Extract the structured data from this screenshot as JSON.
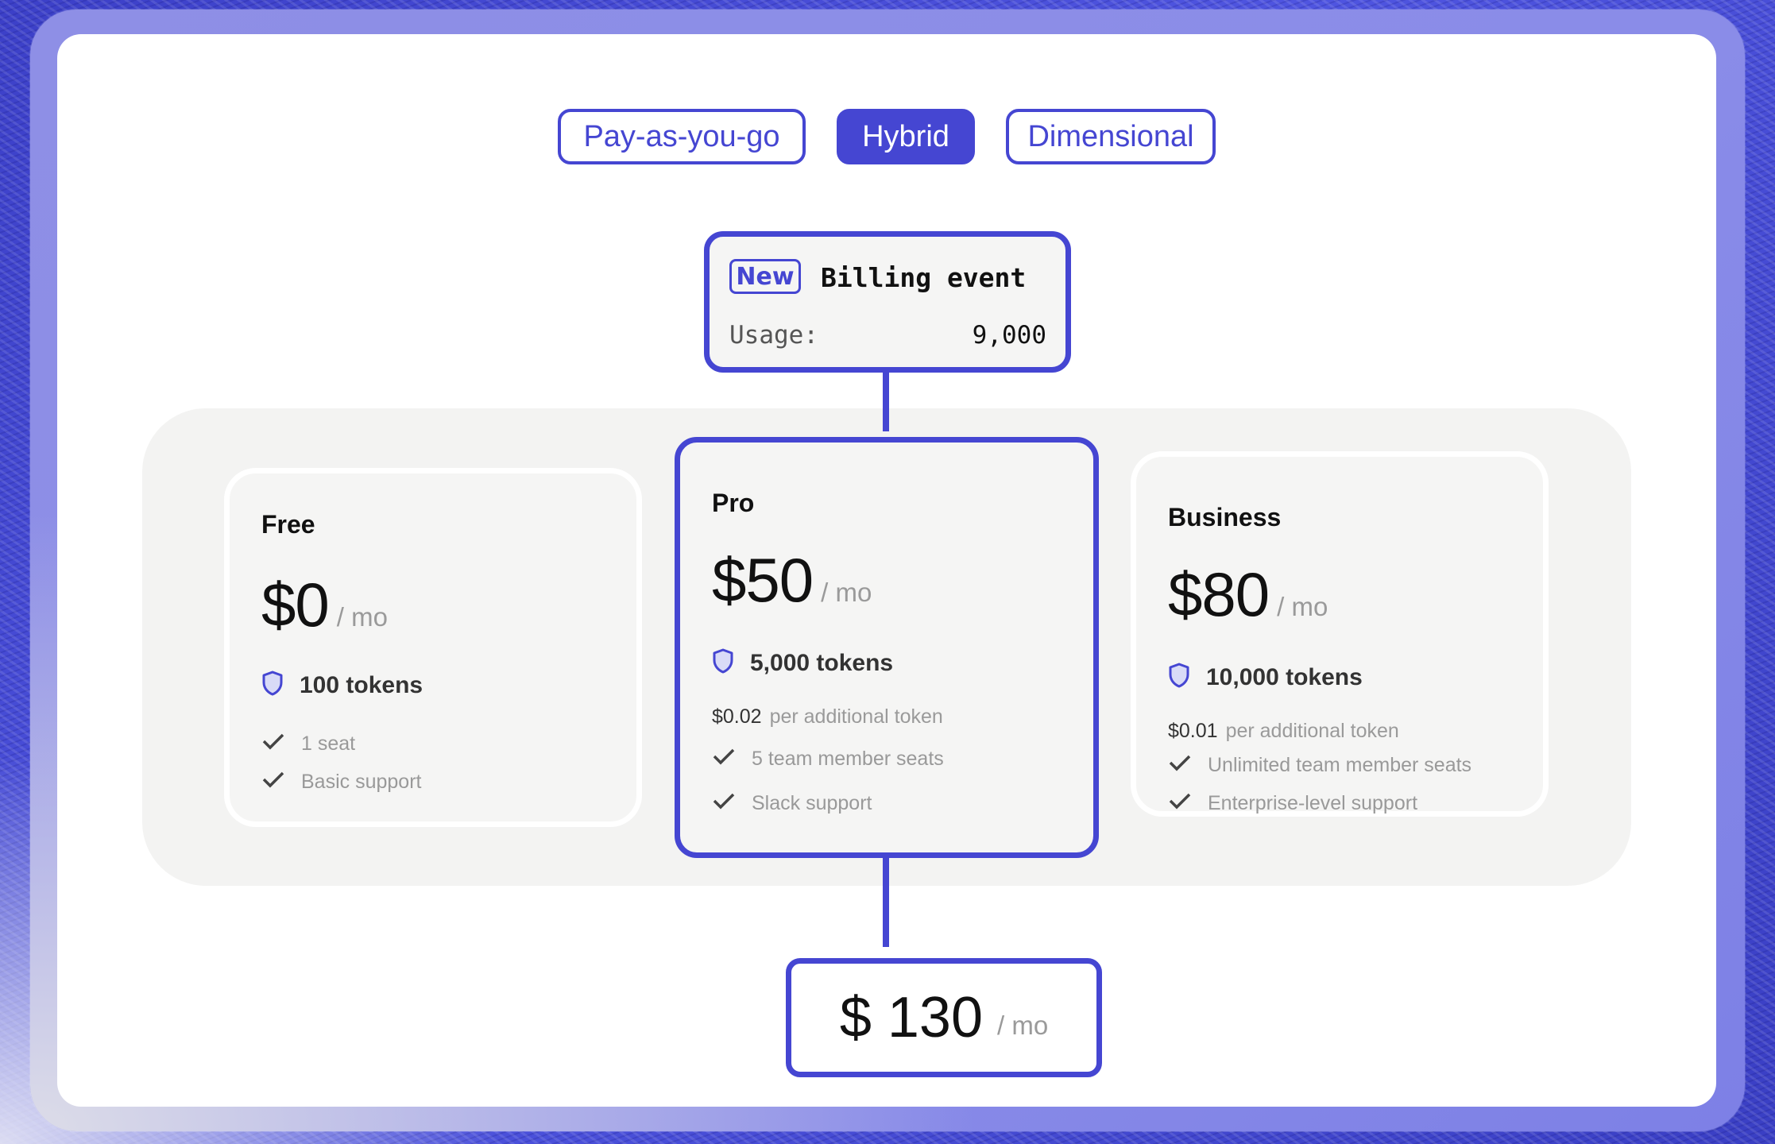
{
  "tabs": [
    {
      "label": "Pay-as-you-go",
      "active": false
    },
    {
      "label": "Hybrid",
      "active": true
    },
    {
      "label": "Dimensional",
      "active": false
    }
  ],
  "billing_event": {
    "badge": "New",
    "title": "Billing event",
    "usage_label": "Usage:",
    "usage_value": "9,000"
  },
  "plans": [
    {
      "name": "Free",
      "price": "$0",
      "per": "/ mo",
      "tokens": "100 tokens",
      "features": [
        "1 seat",
        "Basic support"
      ]
    },
    {
      "name": "Pro",
      "price": "$50",
      "per": "/ mo",
      "tokens": "5,000 tokens",
      "additional_amount": "$0.02",
      "additional_label": "per additional token",
      "features": [
        "5 team member seats",
        "Slack support"
      ],
      "selected": true
    },
    {
      "name": "Business",
      "price": "$80",
      "per": "/ mo",
      "tokens": "10,000 tokens",
      "additional_amount": "$0.01",
      "additional_label": "per additional token",
      "features": [
        "Unlimited team member seats",
        "Enterprise-level support"
      ]
    }
  ],
  "total": {
    "amount": "$ 130",
    "per": "/ mo"
  },
  "colors": {
    "accent": "#4546d2",
    "card_bg": "#f5f5f4",
    "muted": "#9a9a9a"
  },
  "icons": {
    "tokens": "shield-icon",
    "feature": "check-icon"
  }
}
